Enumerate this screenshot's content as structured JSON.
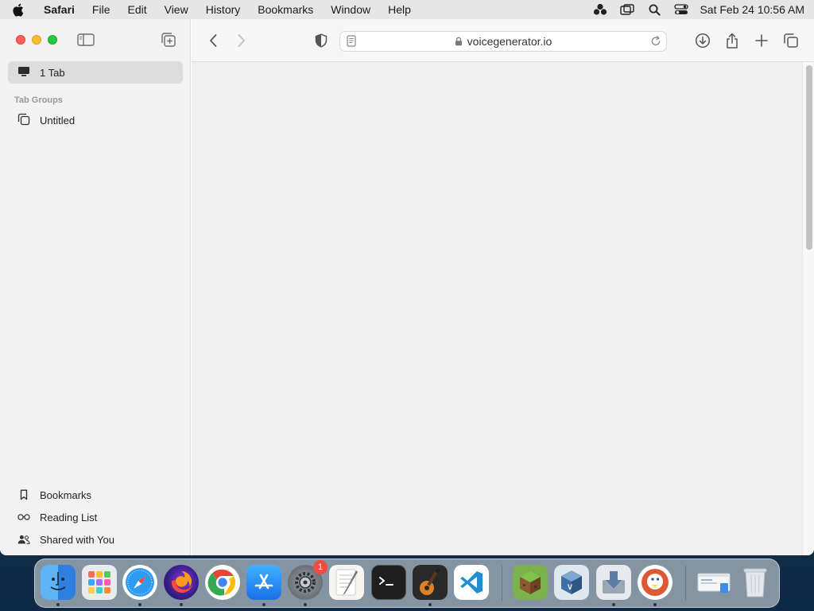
{
  "menubar": {
    "app_name": "Safari",
    "menus": [
      "File",
      "Edit",
      "View",
      "History",
      "Bookmarks",
      "Window",
      "Help"
    ],
    "clock": "Sat Feb 24  10:56 AM"
  },
  "sidebar": {
    "tabs_label": "1 Tab",
    "tab_groups_header": "Tab Groups",
    "group_name": "Untitled",
    "bottom_items": [
      "Bookmarks",
      "Reading List",
      "Shared with You"
    ]
  },
  "toolbar": {
    "url": "voicegenerator.io"
  },
  "dock": {
    "apps": [
      "Finder",
      "Launchpad",
      "Safari",
      "Firefox",
      "Chrome",
      "App Store",
      "System Preferences",
      "TextEdit",
      "Terminal",
      "GarageBand",
      "Visual Studio Code",
      "Minecraft",
      "VirtualBox",
      "Downloads",
      "DuckDuckGo",
      "Preview",
      "Trash"
    ],
    "settings_badge": "1"
  },
  "colors": {
    "close": "#ff5f57",
    "minimize": "#febc2e",
    "maximize": "#28c840",
    "badge": "#f24b3f"
  }
}
